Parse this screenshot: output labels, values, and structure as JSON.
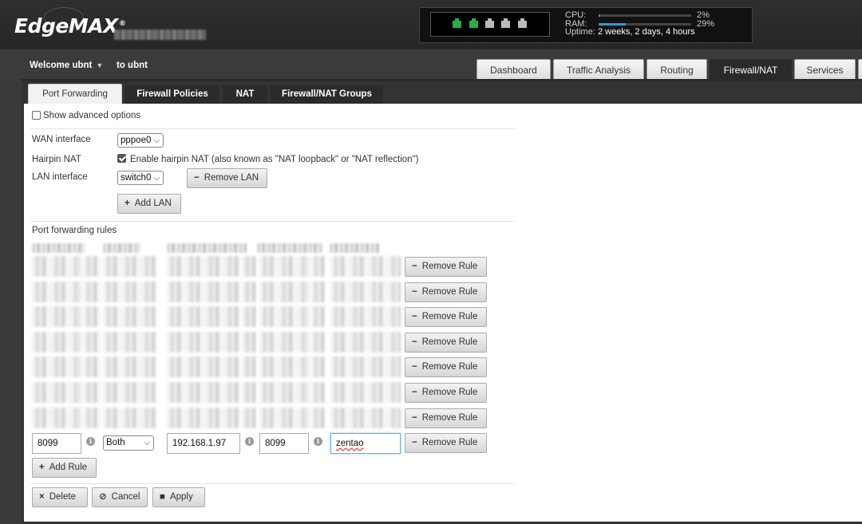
{
  "header": {
    "logo": "EdgeMAX",
    "logo_mark": "®",
    "stats": {
      "cpu_label": "CPU:",
      "cpu_value": "2%",
      "cpu_fraction": 0.02,
      "ram_label": "RAM:",
      "ram_value": "29%",
      "ram_fraction": 0.29,
      "uptime_label": "Uptime:",
      "uptime_value": "2 weeks, 2 days, 4 hours"
    },
    "ports": [
      "up",
      "up",
      "down",
      "down",
      "down"
    ]
  },
  "nav": {
    "welcome": "Welcome ubnt",
    "to_user": "to ubnt",
    "tabs": [
      "Dashboard",
      "Traffic Analysis",
      "Routing",
      "Firewall/NAT",
      "Services"
    ],
    "active_tab": "Firewall/NAT"
  },
  "subtabs": {
    "items": [
      "Port Forwarding",
      "Firewall Policies",
      "NAT",
      "Firewall/NAT Groups"
    ],
    "active": "Port Forwarding"
  },
  "form": {
    "show_advanced_label": "Show advanced options",
    "show_advanced_checked": false,
    "wan_label": "WAN interface",
    "wan_value": "pppoe0",
    "hairpin_label": "Hairpin NAT",
    "hairpin_text": "Enable hairpin NAT (also known as \"NAT loopback\" or \"NAT reflection\")",
    "hairpin_checked": true,
    "lan_label": "LAN interface",
    "lan_value": "switch0",
    "remove_lan": "Remove LAN",
    "add_lan": "Add LAN",
    "rules_label": "Port forwarding rules",
    "remove_rule": "Remove Rule",
    "last_rule": {
      "original_port": "8099",
      "protocol": "Both",
      "forward_to_address": "192.168.1.97",
      "forward_to_port": "8099",
      "description": "zentao"
    },
    "add_rule": "Add Rule",
    "delete": "Delete",
    "cancel": "Cancel",
    "apply": "Apply"
  },
  "icons": {
    "minus": "−",
    "plus": "+",
    "times": "×",
    "cancel": "⊘",
    "save": "■",
    "info": "i",
    "chevron": "⌵"
  }
}
